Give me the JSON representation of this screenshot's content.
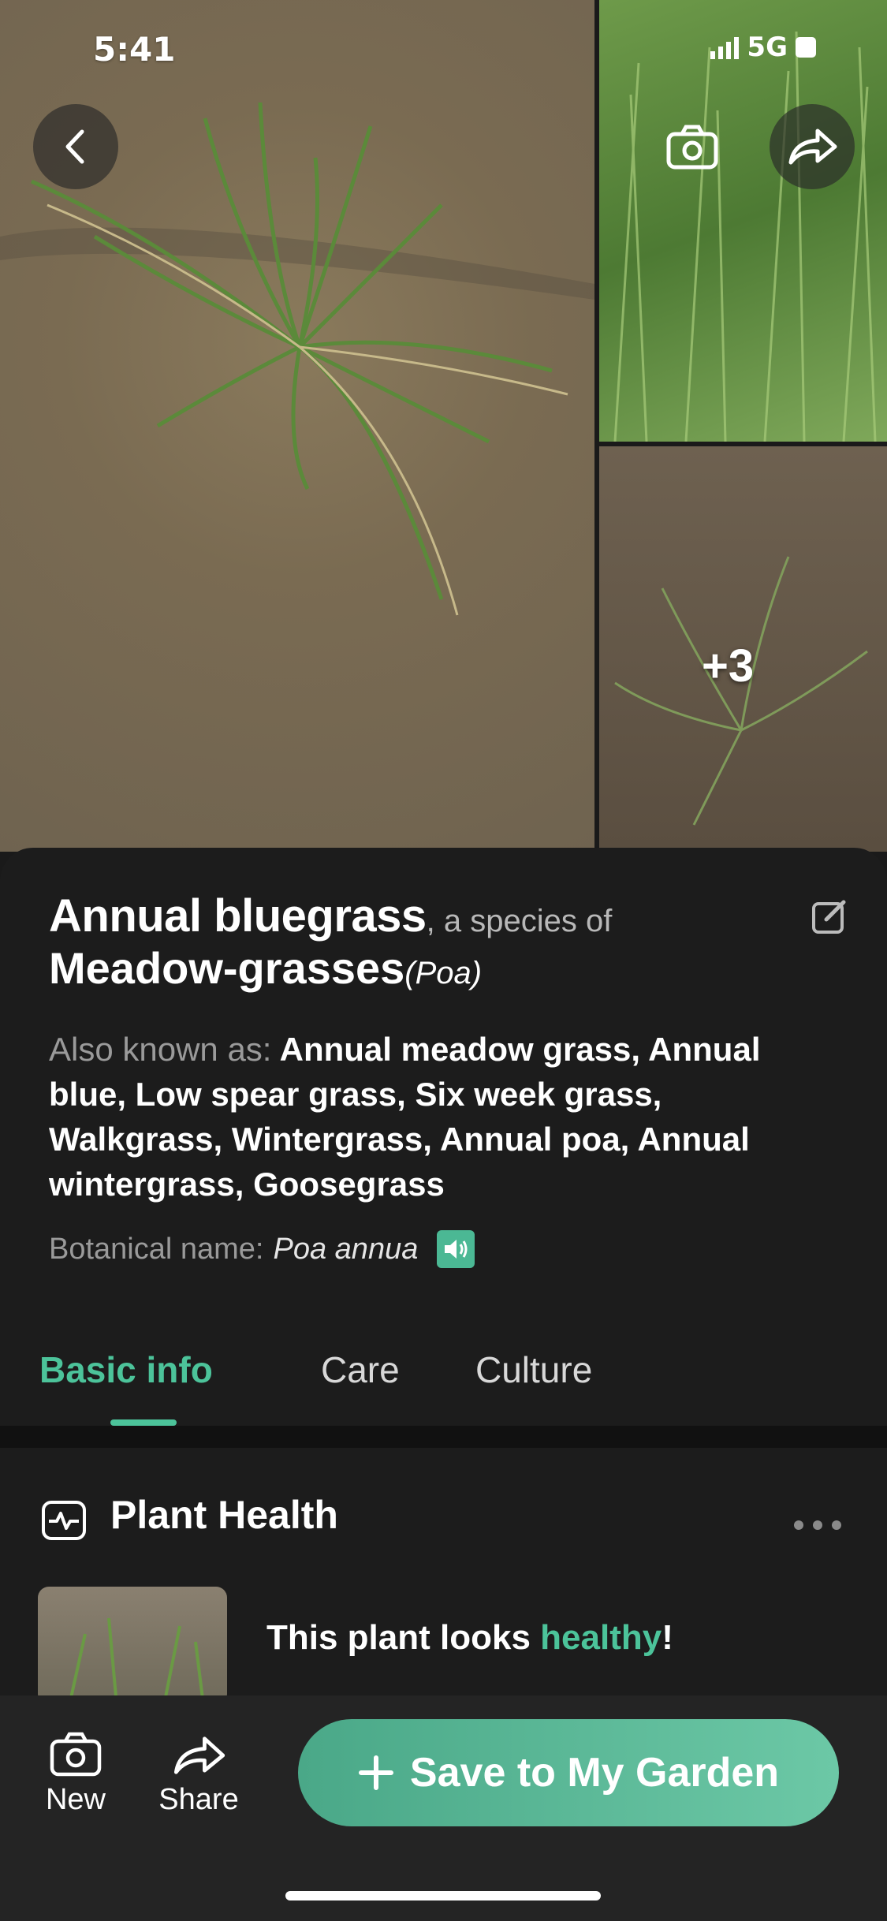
{
  "status_bar": {
    "time": "5:41",
    "network": "5G"
  },
  "gallery": {
    "more_count": "+3"
  },
  "plant": {
    "common_name": "Annual bluegrass",
    "species_of_text": ", a species of",
    "genus_common": "Meadow-grasses",
    "genus_latin": "(Poa)",
    "aka_label": "Also known as:",
    "aka_values": "Annual meadow grass, Annual blue, Low spear grass, Six week grass, Walkgrass, Wintergrass, Annual poa, Annual wintergrass, Goosegrass",
    "botanical_label": "Botanical name:",
    "botanical_name": "Poa annua"
  },
  "tabs": [
    {
      "label": "Basic info",
      "active": true
    },
    {
      "label": "Care",
      "active": false
    },
    {
      "label": "Culture",
      "active": false
    }
  ],
  "plant_health": {
    "title": "Plant Health",
    "status_prefix": "This plant looks ",
    "status_word": "healthy",
    "status_suffix": "!"
  },
  "bottom_bar": {
    "new_label": "New",
    "share_label": "Share",
    "save_label": "Save to My Garden"
  },
  "colors": {
    "accent": "#4cc39a",
    "background": "#1c1c1c"
  },
  "icons": [
    "back-icon",
    "camera-icon",
    "share-icon",
    "edit-icon",
    "speaker-icon",
    "health-monitor-icon",
    "more-icon",
    "plus-icon"
  ]
}
